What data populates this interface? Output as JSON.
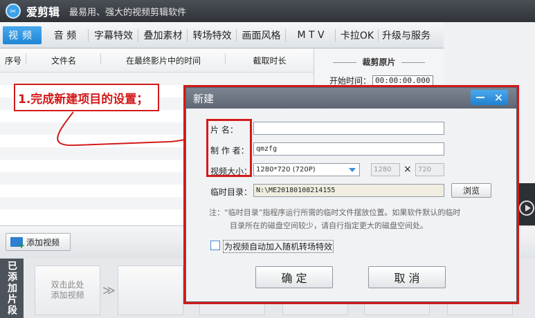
{
  "app": {
    "logo_glyph": "✂",
    "name": "爱剪辑",
    "slogan": "最易用、强大的视频剪辑软件"
  },
  "tabs": [
    {
      "label": "视频",
      "active": true
    },
    {
      "label": "音  频"
    },
    {
      "label": "字幕特效"
    },
    {
      "label": "叠加素材"
    },
    {
      "label": "转场特效"
    },
    {
      "label": "画面风格"
    },
    {
      "label": "M T V"
    },
    {
      "label": "卡拉OK"
    },
    {
      "label": "升级与服务"
    }
  ],
  "table": {
    "columns": [
      "序号",
      "文件名",
      "在最终影片中的时间",
      "截取时长"
    ]
  },
  "crop": {
    "title": "裁剪原片",
    "start_label": "开始时间：",
    "start_value": "00:00:00.000"
  },
  "addbar": {
    "add_label": "添加视频"
  },
  "clips": {
    "label": "已添加片段",
    "first_clip_text": "双击此处\n添加视频",
    "arrow": "≫"
  },
  "annotation": {
    "text": "1.完成新建项目的设置；"
  },
  "dialog": {
    "title": "新建",
    "min_glyph": "",
    "close_glyph": "✕",
    "fields": {
      "name_label": "片    名：",
      "name_value": "",
      "author_label": "制 作 者：",
      "author_value": "qmzfg",
      "size_label": "视频大小：",
      "size_value": "1280*720 (720P)",
      "width_value": "1280",
      "times_glyph": "×",
      "height_value": "720",
      "temp_label": "临时目录：",
      "temp_value": "N:\\ME20180108214155",
      "browse_label": "浏览"
    },
    "note_line1": "注：“临时目录”指程序运行所需的临时文件摆放位置。如果软件默认的临时",
    "note_line2": "目录所在的磁盘空间较少，请自行指定更大的磁盘空间处。",
    "checkbox_label": "为视频自动加入随机转场特效",
    "ok_label": "确  定",
    "cancel_label": "取  消"
  },
  "colors": {
    "accent": "#1f86d6",
    "annotation_red": "#d21a1a"
  }
}
